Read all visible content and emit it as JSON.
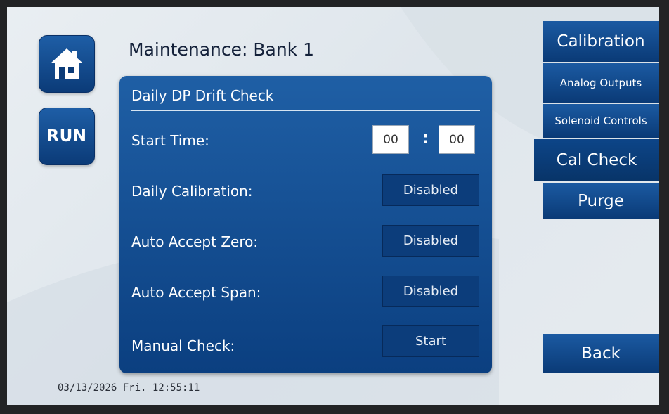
{
  "header": {
    "title": "Maintenance: Bank 1"
  },
  "left_buttons": {
    "home_icon": "home-icon",
    "run_label": "RUN"
  },
  "panel": {
    "heading": "Daily DP Drift Check",
    "start_time": {
      "label": "Start Time:",
      "hours": "00",
      "minutes": "00",
      "separator": ":"
    },
    "daily_calibration": {
      "label": "Daily Calibration:",
      "value": "Disabled"
    },
    "auto_accept_zero": {
      "label": "Auto Accept Zero:",
      "value": "Disabled"
    },
    "auto_accept_span": {
      "label": "Auto Accept Span:",
      "value": "Disabled"
    },
    "manual_check": {
      "label": "Manual Check:",
      "value": "Start"
    }
  },
  "menu": {
    "calibration": "Calibration",
    "analog_outputs": "Analog Outputs",
    "solenoid_controls": "Solenoid Controls",
    "cal_check": "Cal Check",
    "purge": "Purge",
    "back": "Back",
    "active_item": "Cal Check"
  },
  "status_bar": {
    "date": "03/13/2026",
    "day_time": "Fri. 12:55:11"
  },
  "colors": {
    "panel": "#1a569c",
    "button": "#0c3d7b",
    "background": "#e4eaef"
  }
}
